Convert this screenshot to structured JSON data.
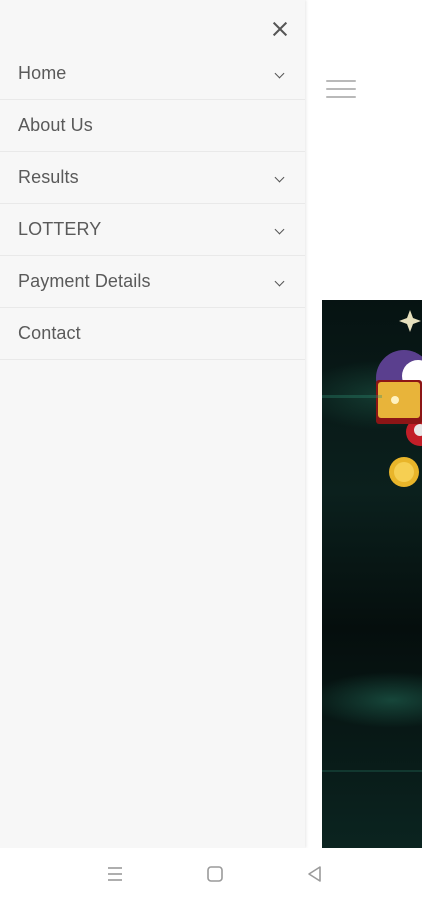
{
  "drawer": {
    "items": [
      {
        "label": "Home",
        "has_submenu": true
      },
      {
        "label": "About Us",
        "has_submenu": false
      },
      {
        "label": "Results",
        "has_submenu": true
      },
      {
        "label": "LOTTERY",
        "has_submenu": true
      },
      {
        "label": "Payment Details",
        "has_submenu": true
      },
      {
        "label": "Contact",
        "has_submenu": false
      }
    ],
    "close_icon": "close-icon",
    "submenu_icon": "chevron-down-icon"
  },
  "page": {
    "menu_icon": "hamburger-icon"
  },
  "navbar": {
    "icons": [
      "recent-apps-icon",
      "home-icon",
      "back-icon"
    ]
  },
  "colors": {
    "drawer_bg": "#f7f7f7",
    "menu_text": "#5a5a5a",
    "banner_bg": "#061312"
  }
}
